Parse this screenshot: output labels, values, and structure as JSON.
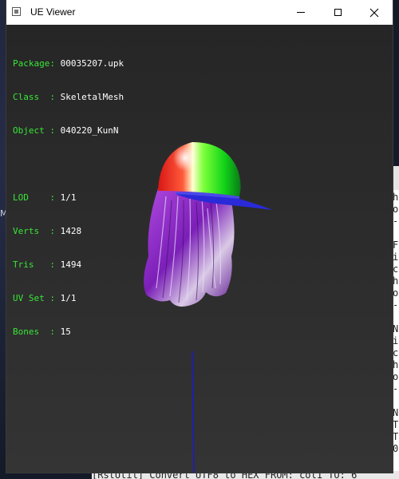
{
  "window": {
    "title": "UE Viewer"
  },
  "mesh_info": {
    "package_label": "Package:",
    "package": "00035207.upk",
    "class_label": "Class  :",
    "class": "SkeletalMesh",
    "object_label": "Object :",
    "object": "040220_KunN",
    "lod_label": "LOD    :",
    "lod": "1/1",
    "verts_label": "Verts  :",
    "verts": "1428",
    "tris_label": "Tris   :",
    "tris": "1494",
    "uvset_label": "UV Set :",
    "uvset": "1/1",
    "bones_label": "Bones  :",
    "bones": "15"
  },
  "background": {
    "console_lines": [
      "h",
      "o",
      "-",
      "",
      "F",
      "i",
      "c",
      "h",
      "o",
      "-",
      "",
      "N",
      "i",
      "c",
      "h",
      "o",
      "-",
      "",
      "N",
      "T",
      "T",
      "0"
    ],
    "status_text": "[RstUtil] Convert UTF8 to HEX  FROM: col1  TO: 6",
    "edge_letter": "M"
  },
  "colors": {
    "label_green": "#38e638",
    "value_white": "#ffffff",
    "axis_blue": "#1a1ad0"
  }
}
